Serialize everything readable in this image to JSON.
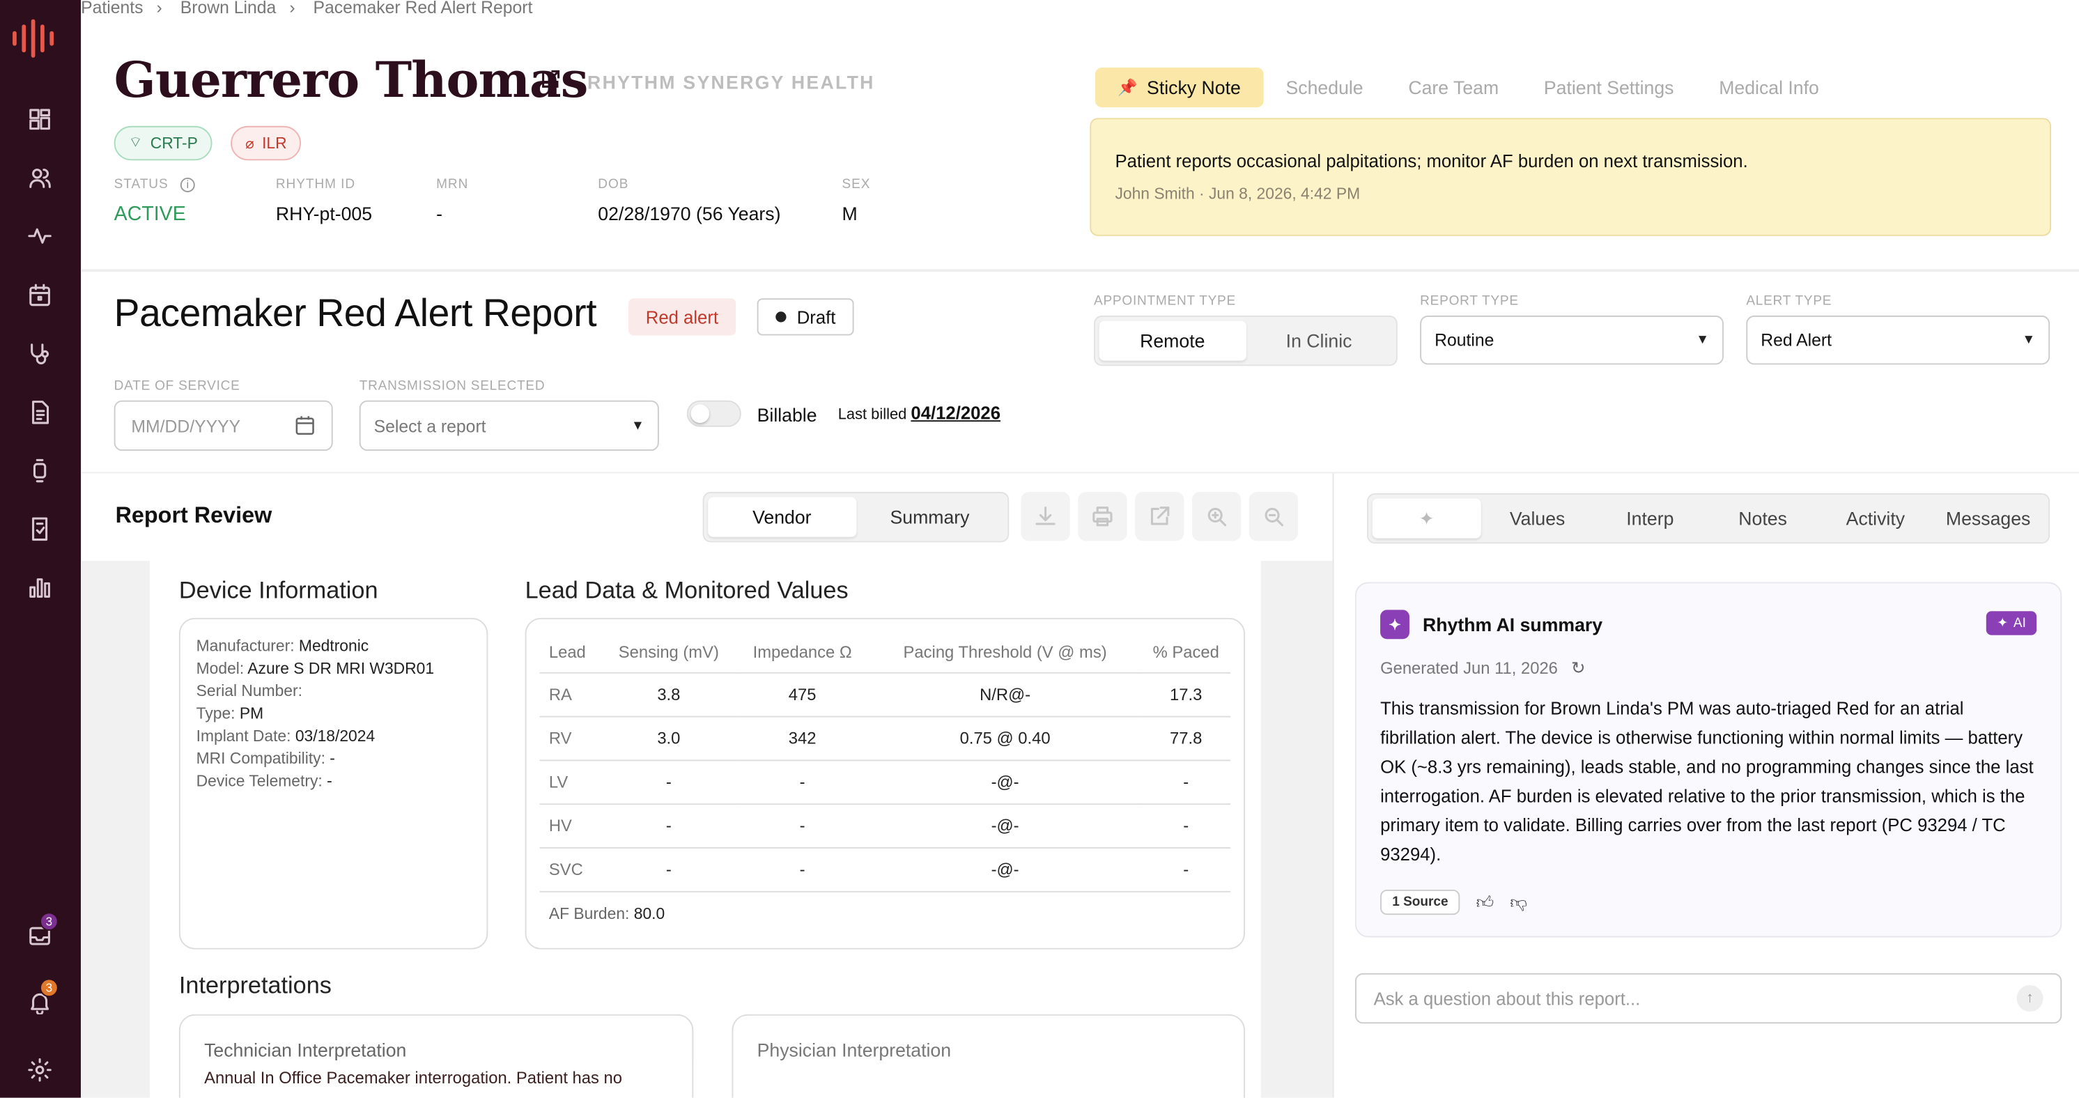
{
  "breadcrumb": [
    "Patients",
    "Brown Linda",
    "Pacemaker Red Alert Report"
  ],
  "patient": {
    "name": "Guerrero Thomas",
    "org": "RHYTHM SYNERGY HEALTH",
    "devices": [
      "CRT-P",
      "ILR"
    ],
    "status_label": "STATUS",
    "status": "ACTIVE",
    "rhythm_id_label": "RHYTHM ID",
    "rhythm_id": "RHY-pt-005",
    "mrn_label": "MRN",
    "mrn": "-",
    "dob_label": "DOB",
    "dob": "02/28/1970 (56 Years)",
    "sex_label": "SEX",
    "sex": "M"
  },
  "top_tabs": [
    "Sticky Note",
    "Schedule",
    "Care Team",
    "Patient Settings",
    "Medical Info"
  ],
  "sticky_note": {
    "text": "Patient reports occasional palpitations; monitor AF burden on next transmission.",
    "byline": "John Smith · Jun 8, 2026, 4:42 PM"
  },
  "report": {
    "title": "Pacemaker Red Alert Report",
    "alert_tag": "Red alert",
    "state": "Draft",
    "appointment_type_label": "APPOINTMENT TYPE",
    "appointment_options": [
      "Remote",
      "In Clinic"
    ],
    "appointment_selected": "Remote",
    "report_type_label": "REPORT TYPE",
    "report_type": "Routine",
    "alert_type_label": "ALERT TYPE",
    "alert_type": "Red Alert",
    "date_label": "DATE OF SERVICE",
    "date_placeholder": "MM/DD/YYYY",
    "transmission_label": "TRANSMISSION SELECTED",
    "transmission_placeholder": "Select a report",
    "billable_label": "Billable",
    "last_billed_label": "Last billed",
    "last_billed": "04/12/2026"
  },
  "review": {
    "title": "Report Review",
    "views": [
      "Vendor",
      "Summary"
    ],
    "selected_view": "Vendor"
  },
  "document": {
    "device_heading": "Device Information",
    "device_fields": [
      {
        "label": "Manufacturer:",
        "value": "Medtronic"
      },
      {
        "label": "Model:",
        "value": "Azure S DR MRI W3DR01"
      },
      {
        "label": "Serial Number:",
        "value": ""
      },
      {
        "label": "Type:",
        "value": "PM"
      },
      {
        "label": "Implant Date:",
        "value": "03/18/2024"
      },
      {
        "label": "MRI Compatibility:",
        "value": "-"
      },
      {
        "label": "Device Telemetry:",
        "value": "-"
      }
    ],
    "lead_heading": "Lead Data & Monitored Values",
    "lead_columns": [
      "Lead",
      "Sensing (mV)",
      "Impedance Ω",
      "Pacing Threshold (V @ ms)",
      "% Paced"
    ],
    "lead_rows": [
      [
        "RA",
        "3.8",
        "475",
        "N/R@-",
        "17.3"
      ],
      [
        "RV",
        "3.0",
        "342",
        "0.75 @ 0.40",
        "77.8"
      ],
      [
        "LV",
        "-",
        "-",
        "-@-",
        "-"
      ],
      [
        "HV",
        "-",
        "-",
        "-@-",
        "-"
      ],
      [
        "SVC",
        "-",
        "-",
        "-@-",
        "-"
      ]
    ],
    "af_burden_label": "AF Burden:",
    "af_burden": "80.0",
    "interp_heading": "Interpretations",
    "tech_interp_title": "Technician Interpretation",
    "tech_interp_text": "Annual In Office Pacemaker interrogation. Patient has no",
    "phys_interp_title": "Physician Interpretation"
  },
  "right_tabs": [
    "",
    "Values",
    "Interp",
    "Notes",
    "Activity",
    "Messages"
  ],
  "ai_summary": {
    "title": "Rhythm AI summary",
    "badge": "AI",
    "generated": "Generated Jun 11, 2026",
    "body": "This transmission for Brown Linda's PM was auto-triaged Red for an atrial fibrillation alert. The device is otherwise functioning within normal limits — battery OK (~8.3 yrs remaining), leads stable, and no programming changes since the last interrogation. AF burden is elevated relative to the prior transmission, which is the primary item to validate. Billing carries over from the last report (PC 93294 / TC 93294).",
    "sources": "1 Source"
  },
  "ask_placeholder": "Ask a question about this report...",
  "sidebar_badges": {
    "inbox": "3",
    "alerts": "3"
  },
  "colors": {
    "sidebar": "#2c0e1c",
    "accent": "#e8584a",
    "active": "#2e9b5a",
    "ai": "#8b3fb6",
    "sticky": "#fcf4c8"
  }
}
